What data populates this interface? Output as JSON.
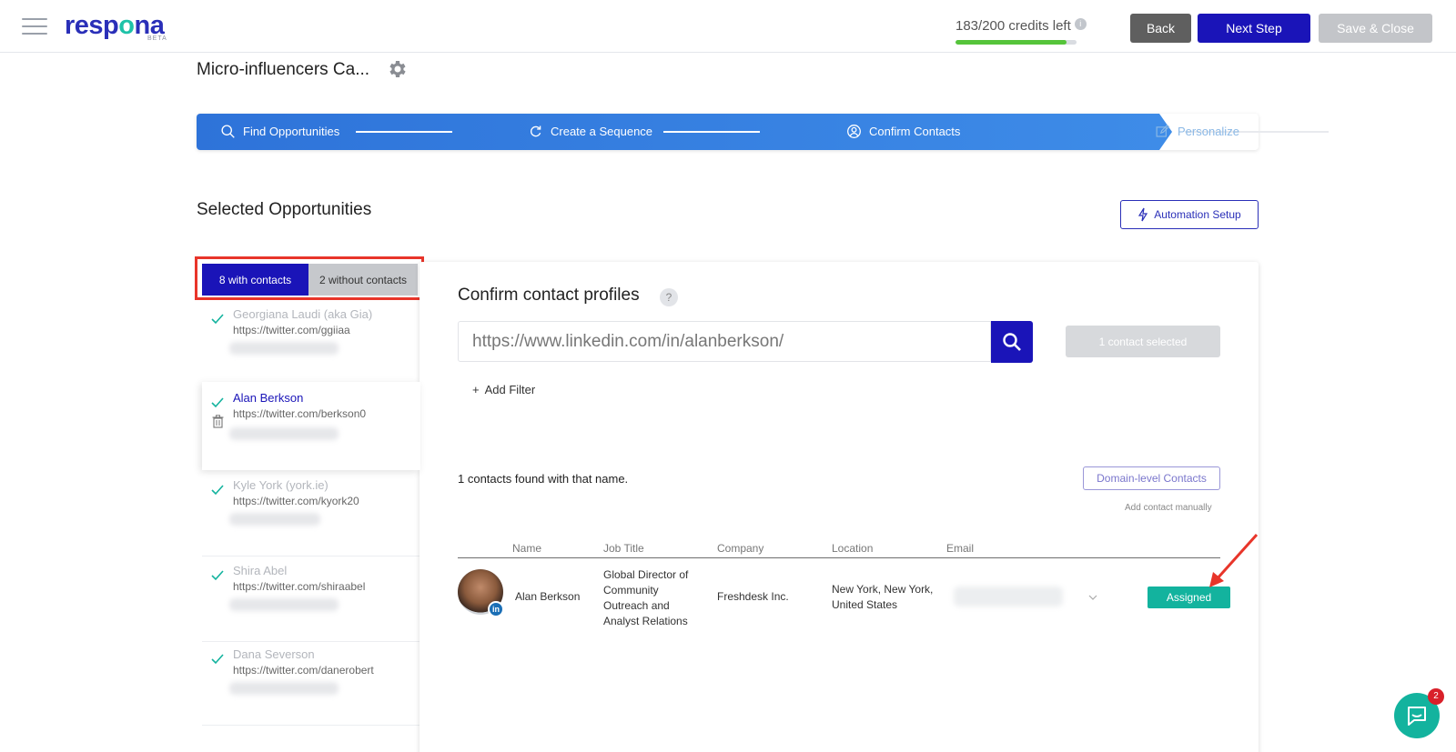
{
  "app": {
    "logo_text_pre": "resp",
    "logo_text_o": "o",
    "logo_text_post": "na",
    "logo_beta": "BETA"
  },
  "header": {
    "credits_text": "183/200 credits left",
    "credits_used": 183,
    "credits_total": 200,
    "back_label": "Back",
    "next_label": "Next Step",
    "save_label": "Save & Close"
  },
  "campaign": {
    "title": "Micro-influencers Ca..."
  },
  "stepper": {
    "steps": [
      {
        "label": "Find Opportunities",
        "icon": "search-icon"
      },
      {
        "label": "Create a Sequence",
        "icon": "refresh-icon"
      },
      {
        "label": "Confirm Contacts",
        "icon": "user-circle-icon"
      },
      {
        "label": "Personalize",
        "icon": "edit-icon"
      }
    ]
  },
  "section": {
    "title": "Selected Opportunities",
    "automation_label": "Automation Setup"
  },
  "tabs": {
    "with_contacts": "8 with contacts",
    "without_contacts": "2 without contacts"
  },
  "opportunities": [
    {
      "name": "Georgiana Laudi (aka Gia)",
      "url": "https://twitter.com/ggiiaa"
    },
    {
      "name": "Alan Berkson",
      "url": "https://twitter.com/berkson0"
    },
    {
      "name": "Kyle York (york.ie)",
      "url": "https://twitter.com/kyork20"
    },
    {
      "name": "Shira Abel",
      "url": "https://twitter.com/shiraabel"
    },
    {
      "name": "Dana Severson",
      "url": "https://twitter.com/danerobert"
    }
  ],
  "confirm": {
    "title": "Confirm contact profiles",
    "help": "?",
    "search_value": "https://www.linkedin.com/in/alanberkson/",
    "selected_label": "1 contact selected",
    "add_filter": "Add Filter",
    "add_filter_plus": "+",
    "found_text": "1 contacts found with that name.",
    "domain_contacts_label": "Domain-level Contacts",
    "add_manually": "Add contact manually",
    "columns": {
      "name": "Name",
      "job_title": "Job Title",
      "company": "Company",
      "location": "Location",
      "email": "Email"
    },
    "contact": {
      "name": "Alan Berkson",
      "job_title": "Global Director of Community Outreach and Analyst Relations",
      "company": "Freshdesk Inc.",
      "location": "New York, New York, United States",
      "linkedin_badge": "in",
      "status_label": "Assigned"
    }
  },
  "chat": {
    "unread": "2"
  },
  "colors": {
    "brand": "#1a14b8",
    "accent": "#13b39e",
    "highlight": "#e8352a"
  }
}
